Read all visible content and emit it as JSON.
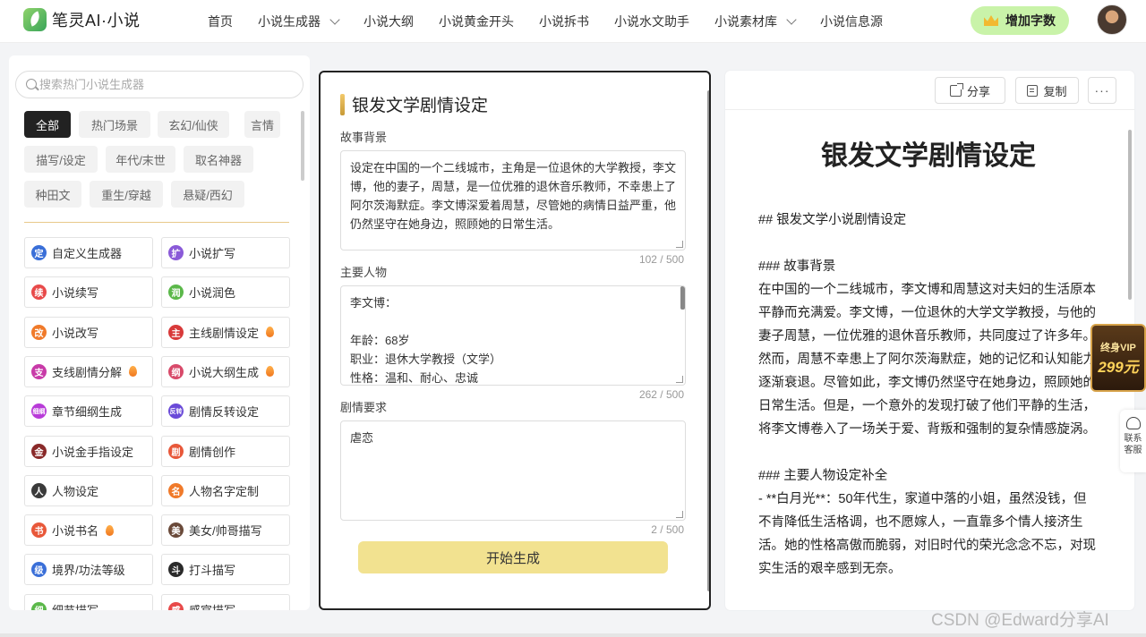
{
  "app": {
    "logo_text": "笔灵AI·小说"
  },
  "nav": {
    "items": [
      {
        "label": "首页",
        "dropdown": false
      },
      {
        "label": "小说生成器",
        "dropdown": true
      },
      {
        "label": "小说大纲",
        "dropdown": false
      },
      {
        "label": "小说黄金开头",
        "dropdown": false
      },
      {
        "label": "小说拆书",
        "dropdown": false
      },
      {
        "label": "小说水文助手",
        "dropdown": false
      },
      {
        "label": "小说素材库",
        "dropdown": true
      },
      {
        "label": "小说信息源",
        "dropdown": false
      }
    ],
    "add_words_label": "增加字数"
  },
  "left": {
    "search_placeholder": "搜索热门小说生成器",
    "tags": [
      "全部",
      "热门场景",
      "玄幻/仙侠",
      "言情",
      "描写/设定",
      "年代/末世",
      "取名神器",
      "种田文",
      "重生/穿越",
      "悬疑/西幻"
    ],
    "active_tag": "全部",
    "tools": [
      {
        "label": "自定义生成器",
        "icon_text": "定",
        "color": "#3a6fd8",
        "hot": false
      },
      {
        "label": "小说扩写",
        "icon_text": "扩",
        "color": "#8a5ad8",
        "hot": false
      },
      {
        "label": "小说续写",
        "icon_text": "续",
        "color": "#e84a4a",
        "hot": false
      },
      {
        "label": "小说润色",
        "icon_text": "润",
        "color": "#5bb84a",
        "hot": false
      },
      {
        "label": "小说改写",
        "icon_text": "改",
        "color": "#f07a2a",
        "hot": false
      },
      {
        "label": "主线剧情设定",
        "icon_text": "主",
        "color": "#d83a3a",
        "hot": true
      },
      {
        "label": "支线剧情分解",
        "icon_text": "支",
        "color": "#c83aa8",
        "hot": true
      },
      {
        "label": "小说大纲生成",
        "icon_text": "纲",
        "color": "#d84a6a",
        "hot": true
      },
      {
        "label": "章节细纲生成",
        "icon_text": "细纲",
        "color": "#b83ad8",
        "hot": false
      },
      {
        "label": "剧情反转设定",
        "icon_text": "反转",
        "color": "#6a4ad8",
        "hot": false
      },
      {
        "label": "小说金手指设定",
        "icon_text": "金",
        "color": "#8a2a2a",
        "hot": false
      },
      {
        "label": "剧情创作",
        "icon_text": "剧",
        "color": "#e8583a",
        "hot": false
      },
      {
        "label": "人物设定",
        "icon_text": "人",
        "color": "#3a3a3a",
        "hot": false
      },
      {
        "label": "人物名字定制",
        "icon_text": "名",
        "color": "#f07a2a",
        "hot": false
      },
      {
        "label": "小说书名",
        "icon_text": "书",
        "color": "#e8583a",
        "hot": true
      },
      {
        "label": "美女/帅哥描写",
        "icon_text": "美",
        "color": "#6a4a3a",
        "hot": false
      },
      {
        "label": "境界/功法等级",
        "icon_text": "级",
        "color": "#3a6fd8",
        "hot": false
      },
      {
        "label": "打斗描写",
        "icon_text": "斗",
        "color": "#2a2a2a",
        "hot": false
      },
      {
        "label": "细节描写",
        "icon_text": "细",
        "color": "#5bb84a",
        "hot": false
      },
      {
        "label": "感官描写",
        "icon_text": "感",
        "color": "#e84a4a",
        "hot": false
      }
    ]
  },
  "mid": {
    "title": "银发文学剧情设定",
    "background_label": "故事背景",
    "background_text": "设定在中国的一个二线城市，主角是一位退休的大学教授，李文博，他的妻子，周慧，是一位优雅的退休音乐教师，不幸患上了阿尔茨海默症。李文博深爱着周慧，尽管她的病情日益严重，他仍然坚守在她身边，照顾她的日常生活。",
    "background_count": "102 / 500",
    "characters_label": "主要人物",
    "characters_lines": [
      "李文博：",
      "",
      "年龄：68岁",
      "职业：退休大学教授（文学）",
      "性格：温和、耐心、忠诚"
    ],
    "characters_count": "262 / 500",
    "plot_label": "剧情要求",
    "plot_text": "虐恋",
    "plot_count": "2 / 500",
    "generate_label": "开始生成"
  },
  "right": {
    "share_label": "分享",
    "copy_label": "复制",
    "more_label": "···",
    "doc_title": "银发文学剧情设定",
    "paragraphs": [
      "## 银发文学小说剧情设定",
      "",
      "### 故事背景",
      "在中国的一个二线城市，李文博和周慧这对夫妇的生活原本平静而充满爱。李文博，一位退休的大学文学教授，与他的妻子周慧，一位优雅的退休音乐教师，共同度过了许多年。然而，周慧不幸患上了阿尔茨海默症，她的记忆和认知能力逐渐衰退。尽管如此，李文博仍然坚守在她身边，照顾她的日常生活。但是，一个意外的发现打破了他们平静的生活，将李文博卷入了一场关于爱、背叛和强制的复杂情感旋涡。",
      "",
      "### 主要人物设定补全",
      "- **白月光**：50年代生，家道中落的小姐，虽然没钱，但不肯降低生活格调，也不愿嫁人，一直靠多个情人接济生活。她的性格高傲而脆弱，对旧时代的荣光念念不忘，对现实生活的艰辛感到无奈。"
    ]
  },
  "widgets": {
    "vip_title": "终身VIP",
    "vip_price": "299元",
    "service_label": "联系客服"
  },
  "watermark": "CSDN @Edward分享AI"
}
